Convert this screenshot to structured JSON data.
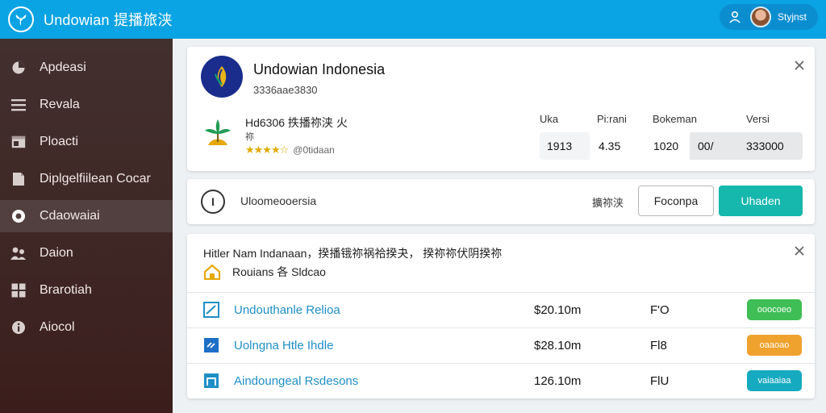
{
  "header": {
    "title": "Undowian 提播旅浃",
    "user_name": "Styjnst",
    "logo_icon": "propeller-logo-icon",
    "colors": {
      "bar": "#0aa3e3",
      "pill": "#0b8ed0"
    }
  },
  "sidebar": {
    "items": [
      {
        "label": "Apdeasi",
        "icon": "pie-chart-icon"
      },
      {
        "label": "Revala",
        "icon": "list-icon"
      },
      {
        "label": "Ploacti",
        "icon": "window-icon"
      },
      {
        "label": "Diplgelfiilean Cocar",
        "icon": "document-icon"
      },
      {
        "label": "Cdaowaiai",
        "icon": "toggle-icon",
        "active": true
      },
      {
        "label": "Daion",
        "icon": "people-icon"
      },
      {
        "label": "Brarotiah",
        "icon": "grid-icon"
      },
      {
        "label": "Aiocol",
        "icon": "info-icon"
      }
    ]
  },
  "company_card": {
    "name": "Undowian Indonesia",
    "subtitle": "3336aae3830",
    "product_title": "Hd6306 抶播祢浃 火",
    "product_tag": "祢",
    "rating_stars": 4,
    "rating_text": "@0tidaan",
    "stats": {
      "headers": [
        "Uka",
        "Pi:rani",
        "Bokeman",
        "Versi"
      ],
      "values": [
        "1913",
        "4.35",
        "1020",
        "00/",
        "333000"
      ]
    }
  },
  "status_card": {
    "icon_text": "I",
    "text": "Uloomeooersia",
    "meta": "擴祢浃",
    "outline_button": "Foconpa",
    "primary_button": "Uhaden",
    "colors": {
      "primary": "#16b7ad"
    }
  },
  "list_card": {
    "title": "Hitler Nam Indanaan，揆播锇祢祸祫揆夬， 揆祢祢伏阴揆祢",
    "subtitle": "Rouians 各 Sldcao",
    "rows": [
      {
        "name": "Undouthanle Relioa",
        "price": "$20.10m",
        "code": "F'O",
        "badge": "ooocoeo",
        "badge_color": "#3fbe55",
        "icon": "chart-icon"
      },
      {
        "name": "Uolngna Htle Ihdle",
        "price": "$28.10m",
        "code": "Fl8",
        "badge": "oaaoao",
        "badge_color": "#f0a22e",
        "icon": "tag-icon"
      },
      {
        "name": "Aindoungeal Rsdesons",
        "price": "126.10m",
        "code": "FlU",
        "badge": "vaiaaiaa",
        "badge_color": "#16aac0",
        "icon": "window-icon"
      }
    ]
  }
}
